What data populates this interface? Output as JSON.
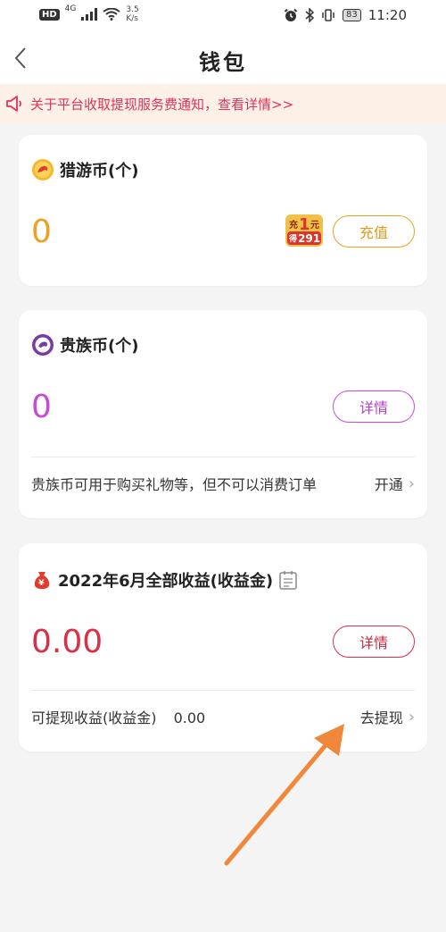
{
  "status_bar": {
    "hd": "HD",
    "net_gen": "4G",
    "speed_value": "3.5",
    "speed_unit": "K/s",
    "battery": "83",
    "time": "11:20"
  },
  "nav": {
    "title": "钱包"
  },
  "notice": {
    "text": "关于平台收取提现服务费通知，查看详情>>"
  },
  "coin_card": {
    "title": "猎游币(个)",
    "value": "0",
    "promo": {
      "top_left": "充",
      "top_mid": "1",
      "top_right": "元",
      "bottom_left": "得",
      "bottom_mid": "291"
    },
    "button": "充值",
    "accent": "#f0a020"
  },
  "noble_card": {
    "title": "贵族币(个)",
    "value": "0",
    "button": "详情",
    "desc": "贵族币可用于购买礼物等，但不可以消费订单",
    "link": "开通",
    "accent": "#c64bd6"
  },
  "income_card": {
    "title": "2022年6月全部收益(收益金)",
    "value": "0.00",
    "button": "详情",
    "withdrawable_label": "可提现收益(收益金)",
    "withdrawable_value": "0.00",
    "link": "去提现",
    "accent": "#d83048"
  }
}
